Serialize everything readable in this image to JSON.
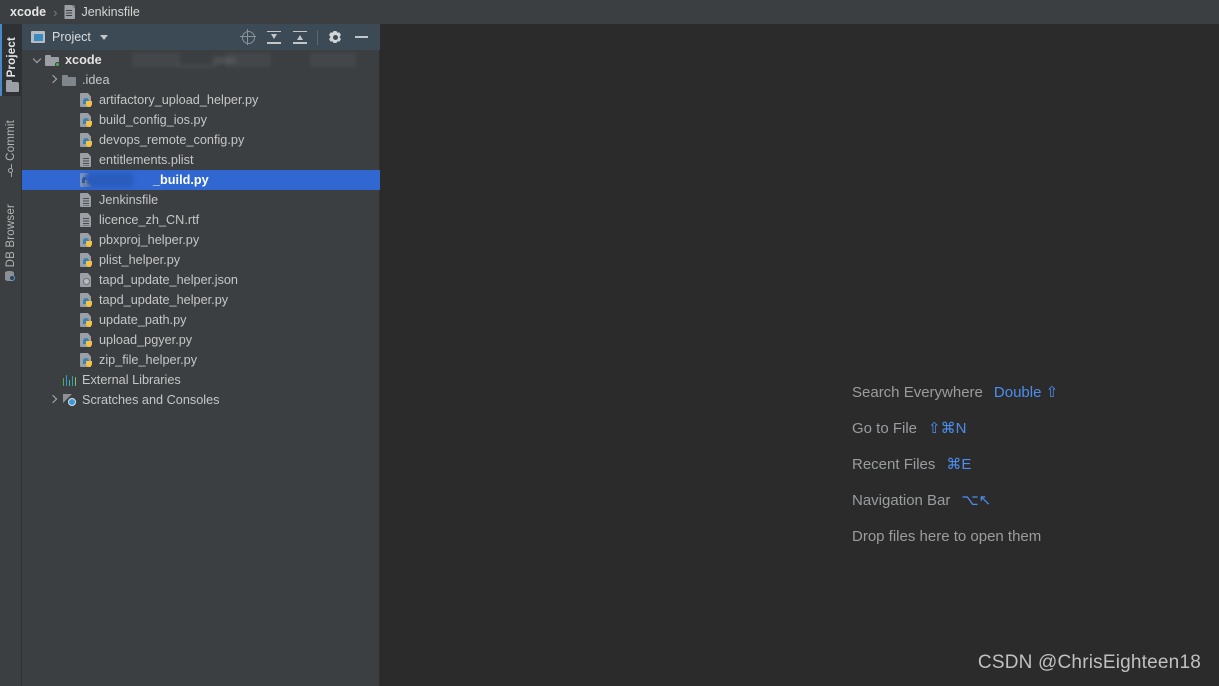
{
  "titlebar": {
    "breadcrumb": [
      {
        "label": "xcode",
        "icon": null,
        "bold": true
      },
      {
        "label": "Jenkinsfile",
        "icon": "document-icon",
        "bold": false
      }
    ],
    "separator": "›"
  },
  "toolstrip": {
    "items": [
      {
        "label": "Project",
        "icon": "folder-icon",
        "active": true
      },
      {
        "label": "Commit",
        "icon": "commit-icon",
        "active": false
      },
      {
        "label": "DB Browser",
        "icon": "database-icon",
        "active": false
      }
    ]
  },
  "panel": {
    "title": "Project",
    "icon": "project-view-icon",
    "dropdown_icon": "chevron-down-icon",
    "actions": [
      {
        "name": "select-opened-file-icon",
        "tooltip": "Select Opened File"
      },
      {
        "name": "expand-all-icon",
        "tooltip": "Expand All"
      },
      {
        "name": "collapse-all-icon",
        "tooltip": "Collapse All"
      },
      {
        "name": "settings-gear-icon",
        "tooltip": "Options"
      },
      {
        "name": "hide-panel-icon",
        "tooltip": "Hide"
      }
    ]
  },
  "tree": {
    "rows": [
      {
        "label": "xcode",
        "icon": "folder-module-icon",
        "indent": 0,
        "twisty": "open",
        "type": "root",
        "selected": false,
        "redacted": true
      },
      {
        "label": ".idea",
        "icon": "folder-icon",
        "indent": 1,
        "twisty": "closed",
        "type": "folder",
        "selected": false
      },
      {
        "label": "artifactory_upload_helper.py",
        "icon": "python-file-icon",
        "indent": 2,
        "twisty": "none",
        "type": "python",
        "selected": false
      },
      {
        "label": "build_config_ios.py",
        "icon": "python-file-icon",
        "indent": 2,
        "twisty": "none",
        "type": "python",
        "selected": false
      },
      {
        "label": "devops_remote_config.py",
        "icon": "python-file-icon",
        "indent": 2,
        "twisty": "none",
        "type": "python",
        "selected": false
      },
      {
        "label": "entitlements.plist",
        "icon": "document-icon",
        "indent": 2,
        "twisty": "none",
        "type": "doc",
        "selected": false
      },
      {
        "label": "_build.py",
        "icon": "python-script-icon",
        "indent": 2,
        "twisty": "none",
        "type": "python-run",
        "selected": true,
        "redacted": true
      },
      {
        "label": "Jenkinsfile",
        "icon": "document-icon",
        "indent": 2,
        "twisty": "none",
        "type": "doc",
        "selected": false
      },
      {
        "label": "licence_zh_CN.rtf",
        "icon": "document-icon",
        "indent": 2,
        "twisty": "none",
        "type": "doc",
        "selected": false
      },
      {
        "label": "pbxproj_helper.py",
        "icon": "python-file-icon",
        "indent": 2,
        "twisty": "none",
        "type": "python",
        "selected": false
      },
      {
        "label": "plist_helper.py",
        "icon": "python-file-icon",
        "indent": 2,
        "twisty": "none",
        "type": "python",
        "selected": false
      },
      {
        "label": "tapd_update_helper.json",
        "icon": "json-file-icon",
        "indent": 2,
        "twisty": "none",
        "type": "json",
        "selected": false
      },
      {
        "label": "tapd_update_helper.py",
        "icon": "python-file-icon",
        "indent": 2,
        "twisty": "none",
        "type": "python",
        "selected": false
      },
      {
        "label": "update_path.py",
        "icon": "python-file-icon",
        "indent": 2,
        "twisty": "none",
        "type": "python",
        "selected": false
      },
      {
        "label": "upload_pgyer.py",
        "icon": "python-file-icon",
        "indent": 2,
        "twisty": "none",
        "type": "python",
        "selected": false
      },
      {
        "label": "zip_file_helper.py",
        "icon": "python-file-icon",
        "indent": 2,
        "twisty": "none",
        "type": "python",
        "selected": false
      },
      {
        "label": "External Libraries",
        "icon": "external-libraries-icon",
        "indent": 1,
        "twisty": "none",
        "type": "libs",
        "selected": false
      },
      {
        "label": "Scratches and Consoles",
        "icon": "scratches-icon",
        "indent": 1,
        "twisty": "closed",
        "type": "scratches",
        "selected": false
      }
    ]
  },
  "editor": {
    "hints": [
      {
        "label": "Search Everywhere",
        "shortcut": "Double ⇧"
      },
      {
        "label": "Go to File",
        "shortcut": "⇧⌘N"
      },
      {
        "label": "Recent Files",
        "shortcut": "⌘E"
      },
      {
        "label": "Navigation Bar",
        "shortcut": "⌥↖"
      },
      {
        "label": "Drop files here to open them",
        "shortcut": ""
      }
    ]
  },
  "watermark": "CSDN @ChrisEighteen18",
  "colors": {
    "titlebar_bg": "#3c3f41",
    "panel_bg": "#3c3f41",
    "panel_header_bg": "#3c4a56",
    "editor_bg": "#2b2b2b",
    "selection_blue": "#3067d0",
    "accent_link": "#4b8ef0",
    "text": "#c6c6c6"
  }
}
